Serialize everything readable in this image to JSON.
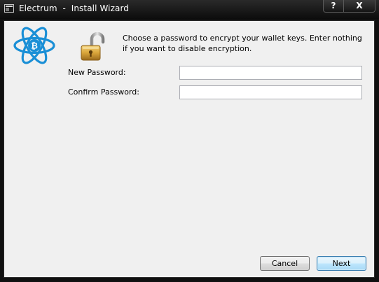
{
  "window": {
    "title": "Electrum  -  Install Wizard",
    "help_label": "?",
    "close_label": "X"
  },
  "content": {
    "message": "Choose a password to encrypt your wallet keys.  Enter nothing if you want to disable encryption.",
    "new_password_label": "New Password:",
    "new_password_value": "",
    "confirm_password_label": "Confirm Password:",
    "confirm_password_value": ""
  },
  "buttons": {
    "cancel_label": "Cancel",
    "next_label": "Next"
  },
  "icons": {
    "app": "window-app-icon",
    "logo": "electrum-logo-icon",
    "lock": "padlock-open-icon"
  },
  "colors": {
    "logo_blue": "#1a8fd6",
    "lock_gold": "#d9a53a",
    "accent_next": "#3c7fb1",
    "client_bg": "#f0f0f0"
  }
}
